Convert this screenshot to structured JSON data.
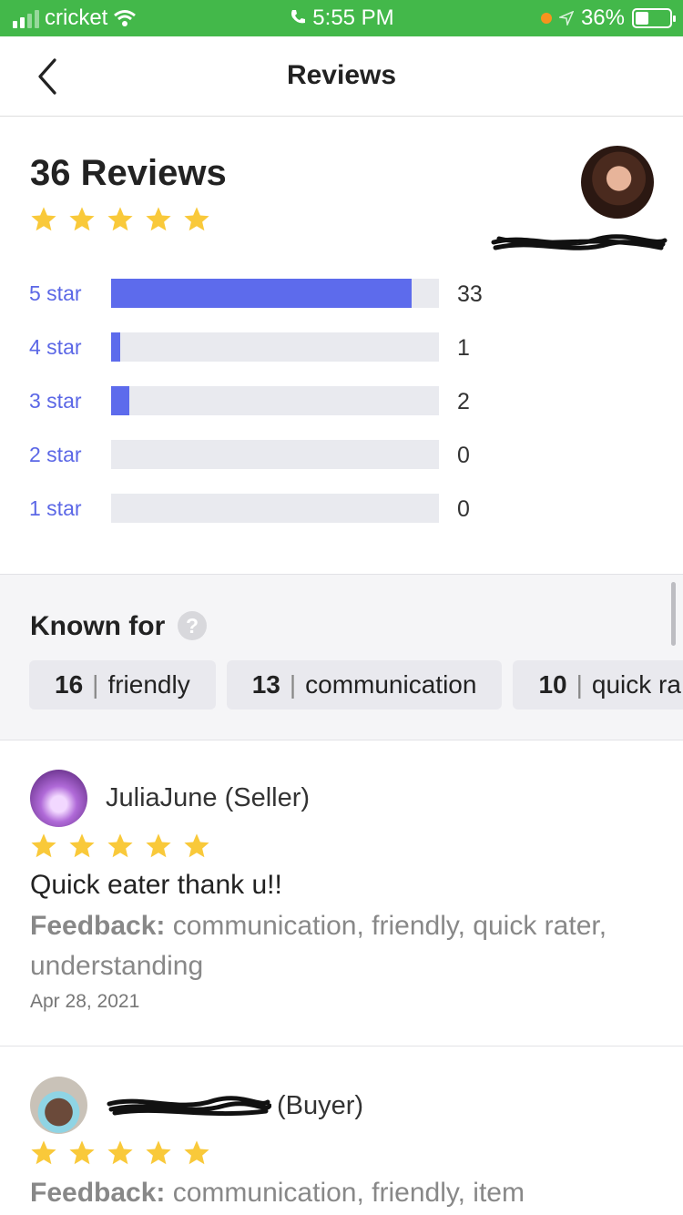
{
  "status_bar": {
    "carrier": "cricket",
    "time": "5:55 PM",
    "battery": "36%"
  },
  "nav": {
    "title": "Reviews",
    "back_icon": "chevron-left-icon"
  },
  "summary": {
    "count_label": "36 Reviews",
    "average_stars": 5,
    "breakdown": [
      {
        "label": "5 star",
        "count": "33",
        "fraction": 0.917
      },
      {
        "label": "4 star",
        "count": "1",
        "fraction": 0.028
      },
      {
        "label": "3 star",
        "count": "2",
        "fraction": 0.056
      },
      {
        "label": "2 star",
        "count": "0",
        "fraction": 0
      },
      {
        "label": "1 star",
        "count": "0",
        "fraction": 0
      }
    ]
  },
  "known_for": {
    "title": "Known for",
    "chips": [
      {
        "count": "16",
        "label": "friendly"
      },
      {
        "count": "13",
        "label": "communication"
      },
      {
        "count": "10",
        "label": "quick ra"
      }
    ]
  },
  "reviews": [
    {
      "name": "JuliaJune (Seller)",
      "stars": 5,
      "comment": "Quick eater thank u!!",
      "feedback_label": "Feedback:",
      "feedback": "communication, friendly, quick rater, understanding",
      "date": "Apr 28, 2021"
    },
    {
      "name": "(Buyer)",
      "stars": 5,
      "feedback_label": "Feedback:",
      "feedback": "communication, friendly, item"
    }
  ],
  "colors": {
    "status_bar": "#43b84a",
    "accent": "#5d6bec",
    "star": "#f9c93a"
  }
}
